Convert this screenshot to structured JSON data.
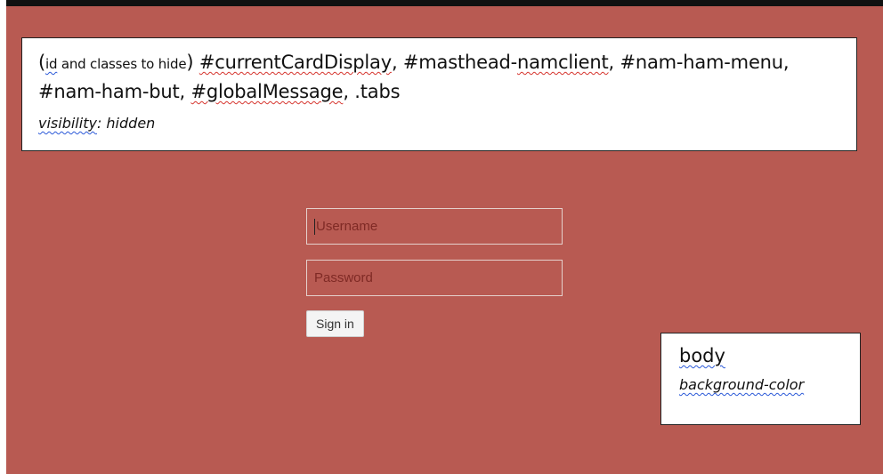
{
  "annotation_top": {
    "open_paren": "(",
    "id_word": "id",
    "classes_text": " and classes to hide",
    "close_paren": ")",
    "selector_1": "#currentCardDisplay",
    "sep_1": ", ",
    "selector_2_prefix": "#masthead-",
    "selector_2_word": "namclient",
    "sep_2": ", #nam-ham-menu, #nam-ham-but, ",
    "selector_3": "#globalMessage",
    "sep_3": ", .tabs",
    "property_name": "visibility",
    "property_value": ": hidden"
  },
  "login_form": {
    "username_placeholder": "Username",
    "password_placeholder": "Password",
    "signin_label": "Sign in"
  },
  "annotation_body": {
    "title": "body",
    "property": "background-color"
  },
  "colors": {
    "background": "#b85a52",
    "input_border": "#e5d0cc",
    "placeholder_text": "#7f2a25",
    "spellcheck_red": "#d6352e",
    "spellcheck_blue": "#2b59d8"
  }
}
